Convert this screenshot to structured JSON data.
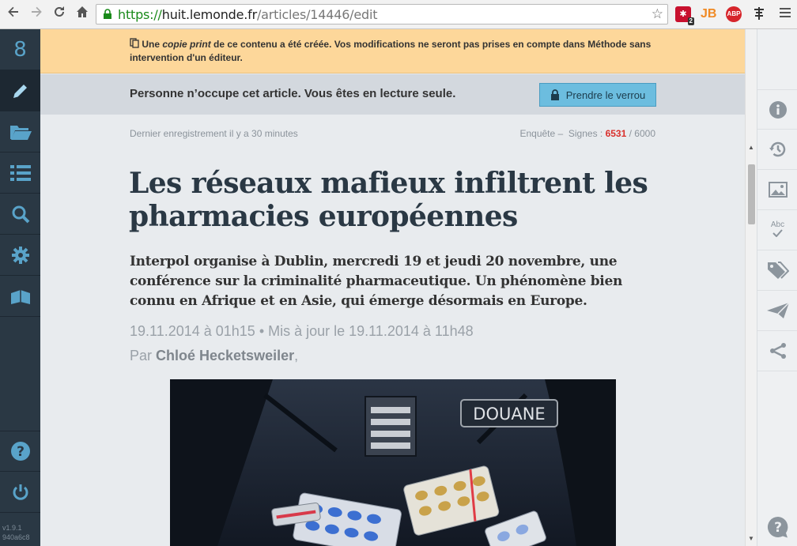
{
  "browser": {
    "url_scheme": "https://",
    "url_host": "huit.lemonde.fr",
    "url_path": "/articles/14446/edit",
    "lastpass_badge": "2",
    "jb_label": "JB",
    "abp_label": "ABP"
  },
  "leftnav": {
    "logo": "8",
    "version": "v1.9.1",
    "build": "940a6c8"
  },
  "warning": {
    "prefix": "Une ",
    "emphasis": "copie print",
    "text": " de ce contenu a été créée. Vos modifications ne seront pas prises en compte dans Méthode sans intervention d'un éditeur."
  },
  "lock_banner": {
    "text": "Personne n’occupe cet article. Vous êtes en lecture seule.",
    "button": "Prendre le verrou"
  },
  "meta": {
    "saved": "Dernier enregistrement il y a 30 minutes",
    "section": "Enquête –",
    "signs_label": "Signes :",
    "signs_count": "6531",
    "signs_max": "/ 6000"
  },
  "article": {
    "headline": "Les réseaux mafieux infiltrent les pharmacies européennes",
    "chapo": "Interpol organise à Dublin, mercredi 19 et jeudi 20 novembre, une conférence sur la criminalité pharmaceutique. Un phénomène bien connu en Afrique et en Asie, qui émerge désormais en Europe.",
    "dates": "19.11.2014 à 01h15 • Mis à jour le 19.11.2014 à 11h48",
    "byline_prefix": "Par ",
    "author": "Chloé Hecketsweiler",
    "byline_suffix": ",",
    "photo_patch_text": "DOUANE"
  }
}
